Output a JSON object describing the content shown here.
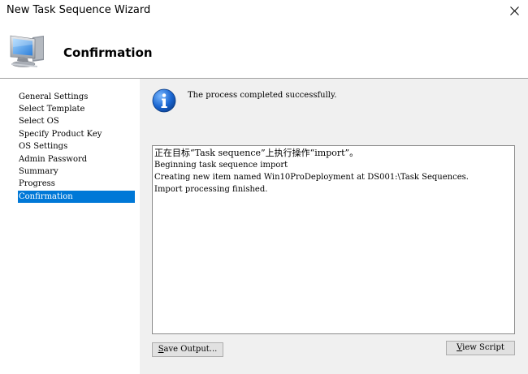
{
  "window": {
    "title": "New Task Sequence Wizard"
  },
  "header": {
    "title": "Confirmation",
    "icon": "computer-monitor-icon"
  },
  "sidebar": {
    "items": [
      {
        "label": "General Settings",
        "selected": false
      },
      {
        "label": "Select Template",
        "selected": false
      },
      {
        "label": "Select OS",
        "selected": false
      },
      {
        "label": "Specify Product Key",
        "selected": false
      },
      {
        "label": "OS Settings",
        "selected": false
      },
      {
        "label": "Admin Password",
        "selected": false
      },
      {
        "label": "Summary",
        "selected": false
      },
      {
        "label": "Progress",
        "selected": false
      },
      {
        "label": "Confirmation",
        "selected": true
      }
    ],
    "selected_color": "#0078d7"
  },
  "main": {
    "status_icon": "info-icon",
    "status_text": "The process completed successfully.",
    "output_lines": [
      "正在目标“Task sequence”上执行操作“import”。",
      "Beginning task sequence import",
      "Creating new item named Win10ProDeployment at DS001:\\Task Sequences.",
      "Import processing finished."
    ],
    "save_output_label": "Save Output...",
    "view_script_label": "View Script"
  },
  "colors": {
    "accent": "#0078d7",
    "panel_background": "#f0f0f0"
  }
}
